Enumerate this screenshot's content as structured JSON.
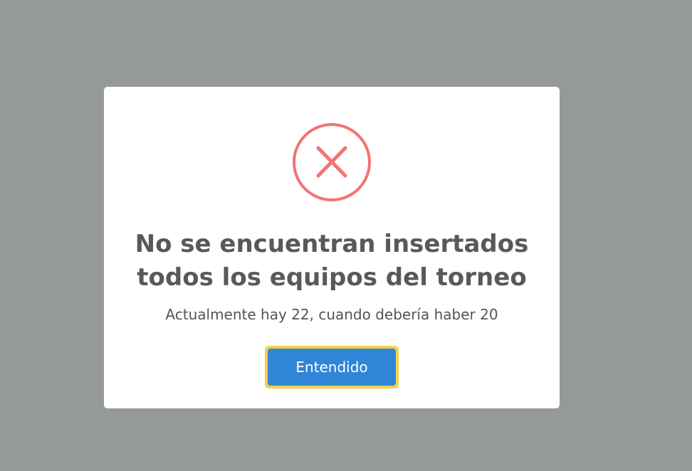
{
  "dialog": {
    "title": "No se encuentran insertados todos los equipos del torneo",
    "message": "Actualmente hay 22, cuando debería haber 20",
    "confirm_label": "Entendido",
    "icon": "error-x-icon"
  },
  "colors": {
    "overlay": "#959a97",
    "modal_bg": "#ffffff",
    "error_icon": "#f27474",
    "button_bg": "#3085d6",
    "button_focus": "#f6cf4a",
    "title_text": "#595959"
  }
}
